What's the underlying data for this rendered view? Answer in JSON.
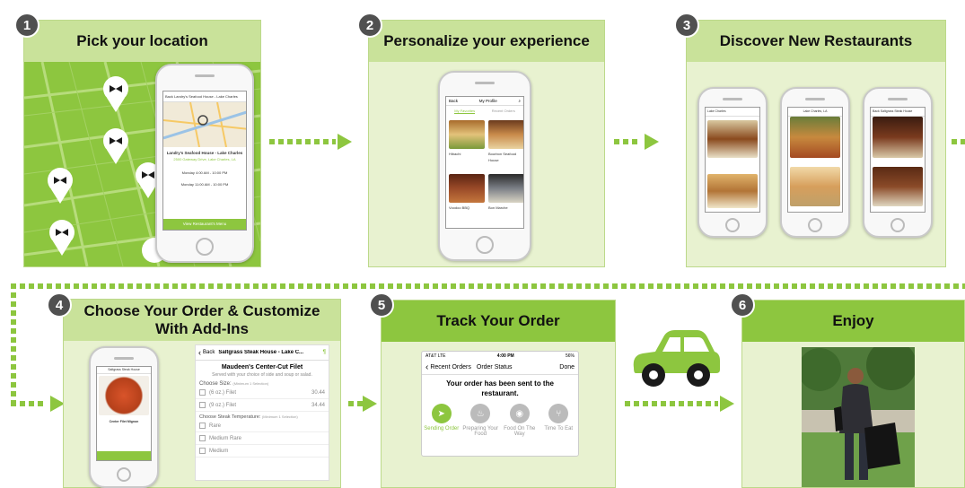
{
  "steps": [
    {
      "num": "1",
      "title": "Pick your location"
    },
    {
      "num": "2",
      "title": "Personalize your experience"
    },
    {
      "num": "3",
      "title": "Discover New Restaurants"
    },
    {
      "num": "4",
      "title": "Choose Your Order & Customize With Add-Ins"
    },
    {
      "num": "5",
      "title": "Track Your Order"
    },
    {
      "num": "6",
      "title": "Enjoy"
    }
  ],
  "step1_screen": {
    "back": "Back  Landry's Seafood House - Lake Charles",
    "name": "Landry's Seafood House - Lake Charles",
    "address": "2500 Gateway Drive, Lake Charles, LA",
    "hours1": "Monday   4:00 AM - 10:00 PM",
    "hours2": "Monday   11:00 AM - 10:00 PM",
    "button": "View Restaurant's Menu"
  },
  "step2_screen": {
    "back": "Back",
    "title": "My Profile",
    "tab1": "My Favorites",
    "tab2": "Recent Orders",
    "items": [
      "Hibachi",
      "Bourbon Seafood House",
      "Voodoo BBQ",
      "Bon Marche"
    ]
  },
  "step3_screens": {
    "s1": "Lake Charles",
    "s2": "Lake Charles, LA",
    "s3": "Back  Saltgrass Steak House"
  },
  "step4_screen": {
    "left_title": "Saltgrass Steak House",
    "left_item": "Center Filet Mignon",
    "back": "Back",
    "header": "Saltgrass Steak House - Lake C...",
    "item": "Maudeen's Center-Cut Filet",
    "desc": "Served with your choice of side and soup or salad.",
    "size_label": "Choose Size:",
    "size_note": "(Minimum 1 Selection)",
    "sizes": [
      {
        "label": "(6 oz.) Filet",
        "price": "30.44"
      },
      {
        "label": "(9 oz.) Filet",
        "price": "34.44"
      }
    ],
    "temp_label": "Choose Steak Temperature:",
    "temp_note": "(Minimum 1 Selection)",
    "temps": [
      "Rare",
      "Medium Rare",
      "Medium"
    ]
  },
  "step5_screen": {
    "carrier": "AT&T  LTE",
    "time": "4:00 PM",
    "battery": "56%",
    "back": "Recent Orders",
    "title": "Order Status",
    "done": "Done",
    "message": "Your order has been sent to the restaurant.",
    "stages": [
      "Sending Order",
      "Preparing Your Food",
      "Food On The Way",
      "Time To Eat"
    ]
  },
  "colors": {
    "accent": "#8dc63f",
    "panel": "#e8f2d0",
    "title_bar": "#c9e29a",
    "badge": "#505050"
  }
}
